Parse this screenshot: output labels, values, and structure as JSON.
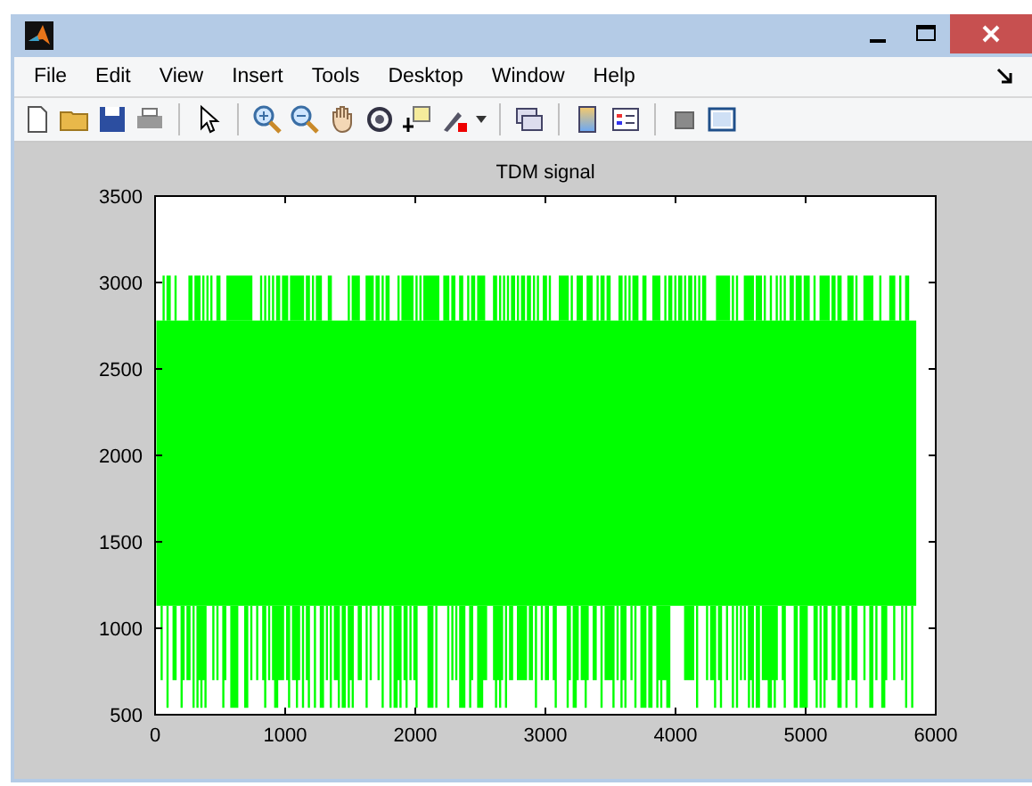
{
  "menu": [
    "File",
    "Edit",
    "View",
    "Insert",
    "Tools",
    "Desktop",
    "Window",
    "Help"
  ],
  "plot": {
    "title": "TDM signal",
    "yticks": [
      "3500",
      "3000",
      "2500",
      "2000",
      "1500",
      "1000",
      "500"
    ],
    "xticks": [
      "0",
      "1000",
      "2000",
      "3000",
      "4000",
      "5000",
      "6000"
    ]
  }
}
